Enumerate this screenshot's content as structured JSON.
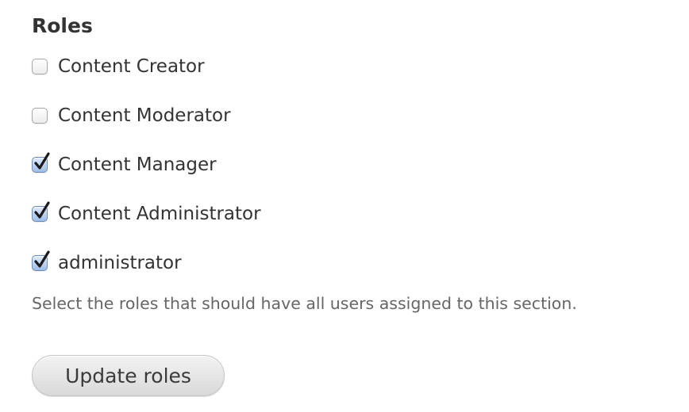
{
  "roles": {
    "title": "Roles",
    "items": [
      {
        "label": "Content Creator",
        "checked": false
      },
      {
        "label": "Content Moderator",
        "checked": false
      },
      {
        "label": "Content Manager",
        "checked": true
      },
      {
        "label": "Content Administrator",
        "checked": true
      },
      {
        "label": "administrator",
        "checked": true
      }
    ],
    "help_text": "Select the roles that should have all users assigned to this section.",
    "button_label": "Update roles"
  },
  "colors": {
    "text": "#333333",
    "help_text": "#666666",
    "checked_fill": "#9fbde6",
    "checkmark": "#1a1a1a"
  },
  "icons": {
    "checkbox_checked": "checkmark-icon"
  }
}
